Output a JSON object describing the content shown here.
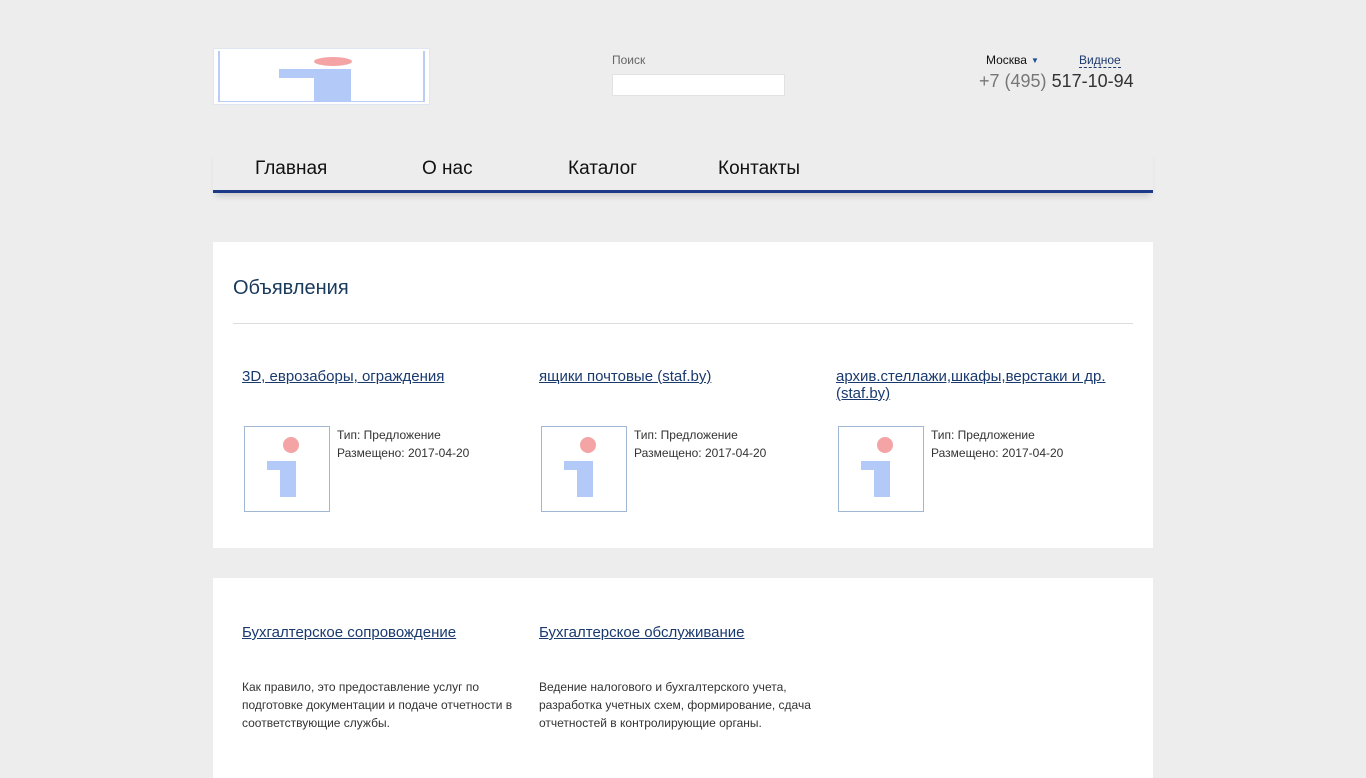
{
  "header": {
    "search_label": "Поиск",
    "search_value": "",
    "search_placeholder": "",
    "city": "Москва",
    "city_alt": "Видное",
    "phone_code": "+7 (495)",
    "phone_number": "517-10-94"
  },
  "nav": {
    "items": [
      "Главная",
      "О нас",
      "Каталог",
      "Контакты"
    ]
  },
  "ads": {
    "title": "Объявления",
    "items": [
      {
        "title": "3D, еврозаборы, ограждения",
        "type": "Тип: Предложение",
        "posted": "Размещено: 2017-04-20"
      },
      {
        "title": "ящики почтовые (staf.by)",
        "type": "Тип: Предложение",
        "posted": "Размещено: 2017-04-20"
      },
      {
        "title": "архив.стеллажи,шкафы,верстаки и др. (staf.by)",
        "type": "Тип: Предложение",
        "posted": "Размещено: 2017-04-20"
      }
    ]
  },
  "services": {
    "items": [
      {
        "title": "Бухгалтерское сопровождение",
        "desc": "Как правило, это предоставление услуг по подготовке документации и подаче отчетности в соответствующие службы."
      },
      {
        "title": "Бухгалтерское обслуживание",
        "desc": "Ведение налогового и бухгалтерского учета, разработка учетных схем, формирование, сдача отчетностей в контролирующие органы."
      }
    ]
  },
  "colors": {
    "background": "#ededed",
    "accent": "#1d3a8a",
    "link": "#1a3a6e",
    "logo_dot": "#f4a4a4",
    "logo_stem": "#b3c9f7"
  },
  "icons": [
    "logo-icon",
    "caret-down-icon",
    "placeholder-image-icon"
  ]
}
